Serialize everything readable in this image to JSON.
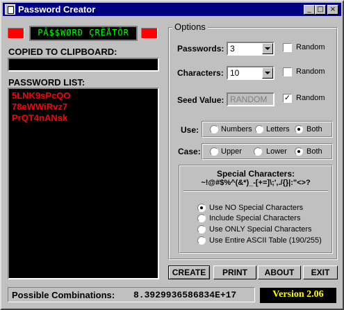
{
  "window": {
    "title": "Password Creator",
    "minimize": "_",
    "maximize": "□",
    "close": "×"
  },
  "banner": {
    "text": "PÂ$$WØRÐ ÇRËÅTÕR"
  },
  "clipboard": {
    "label": "COPIED TO CLIPBOARD:",
    "value": ""
  },
  "password_list": {
    "label": "PASSWORD LIST:",
    "items": [
      "5LNK9sPcQO",
      "78eWWiRvz7",
      "PrQT4nANsk"
    ]
  },
  "options": {
    "legend": "Options",
    "passwords": {
      "label": "Passwords:",
      "value": "3",
      "random_label": "Random",
      "random_checked": false
    },
    "characters": {
      "label": "Characters:",
      "value": "10",
      "random_label": "Random",
      "random_checked": false
    },
    "seed": {
      "label": "Seed Value:",
      "placeholder": "RANDOM",
      "random_label": "Random",
      "random_checked": true,
      "check_mark": "✓"
    },
    "use": {
      "label": "Use:",
      "options": [
        "Numbers",
        "Letters",
        "Both"
      ],
      "selected": "Both"
    },
    "case": {
      "label": "Case:",
      "options": [
        "Upper",
        "Lower",
        "Both"
      ],
      "selected": "Both"
    },
    "special": {
      "title": "Special Characters:",
      "chars": "~!@#$%^(&*)_-[+=]\\;',./{}|:\"<>?",
      "options": [
        "Use NO Special Characters",
        "Include Special  Characters",
        "Use ONLY Special Characters",
        "Use Entire ASCII Table (190/255)"
      ],
      "selected": 0
    }
  },
  "buttons": {
    "create": "CREATE",
    "print": "PRINT",
    "about": "ABOUT",
    "exit": "EXIT"
  },
  "status": {
    "combinations_label": "Possible Combinations:",
    "combinations_value": "8.3929936586834E+17",
    "version": "Version 2.06"
  }
}
